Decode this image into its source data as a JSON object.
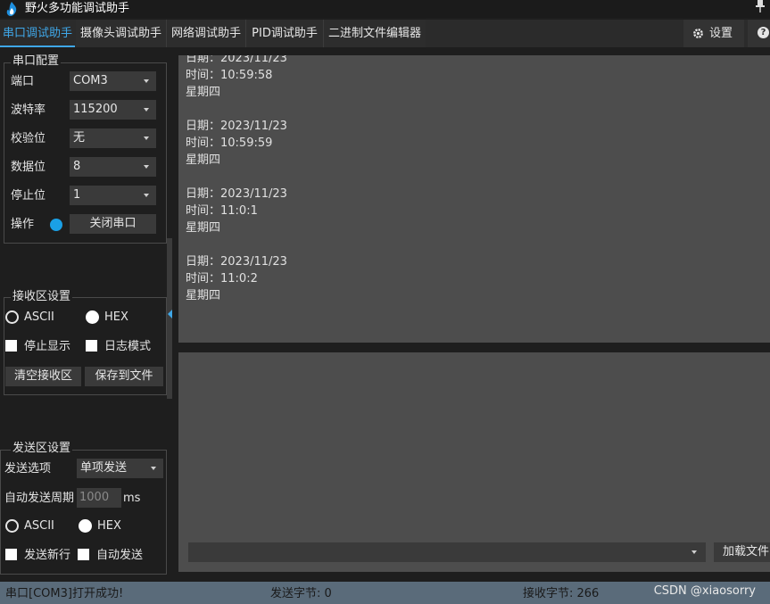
{
  "app": {
    "title": "野火多功能调试助手",
    "pin_glyph": "📌"
  },
  "tabs": [
    {
      "label": "串口调试助手",
      "active": true
    },
    {
      "label": "摄像头调试助手"
    },
    {
      "label": "网络调试助手"
    },
    {
      "label": "PID调试助手"
    },
    {
      "label": "二进制文件编辑器"
    }
  ],
  "toolbar": {
    "settings_label": "设置",
    "help_label": "?"
  },
  "serial_config": {
    "title": "串口配置",
    "port_label": "端口",
    "port_value": "COM3",
    "baud_label": "波特率",
    "baud_value": "115200",
    "parity_label": "校验位",
    "parity_value": "无",
    "databits_label": "数据位",
    "databits_value": "8",
    "stopbits_label": "停止位",
    "stopbits_value": "1",
    "op_label": "操作",
    "close_port_label": "关闭串口",
    "status_color": "#1aa0e6"
  },
  "recv_settings": {
    "title": "接收区设置",
    "ascii_label": "ASCII",
    "hex_label": "HEX",
    "stop_display_label": "停止显示",
    "log_mode_label": "日志模式",
    "clear_label": "清空接收区",
    "save_label": "保存到文件"
  },
  "send_settings": {
    "title": "发送区设置",
    "option_label": "发送选项",
    "option_value": "单项发送",
    "period_label": "自动发送周期",
    "period_placeholder": "1000",
    "period_unit": "ms",
    "ascii_label": "ASCII",
    "hex_label": "HEX",
    "newline_label": "发送新行",
    "auto_send_label": "自动发送"
  },
  "receive_text": "日期：2023/11/23\n时间：10:59:58\n星期四\n\n日期：2023/11/23\n时间：10:59:59\n星期四\n\n日期：2023/11/23\n时间：11:0:1\n星期四\n\n日期：2023/11/23\n时间：11:0:2\n星期四",
  "send_panel": {
    "load_file_label": "加载文件"
  },
  "status": {
    "message": "串口[COM3]打开成功!",
    "sent_bytes": "发送字节: 0",
    "recv_bytes": "接收字节: 266",
    "watermark": "CSDN @xiaosorry"
  },
  "colors": {
    "accent": "#3fa7e8",
    "statusbar": "#5a6b7a"
  }
}
